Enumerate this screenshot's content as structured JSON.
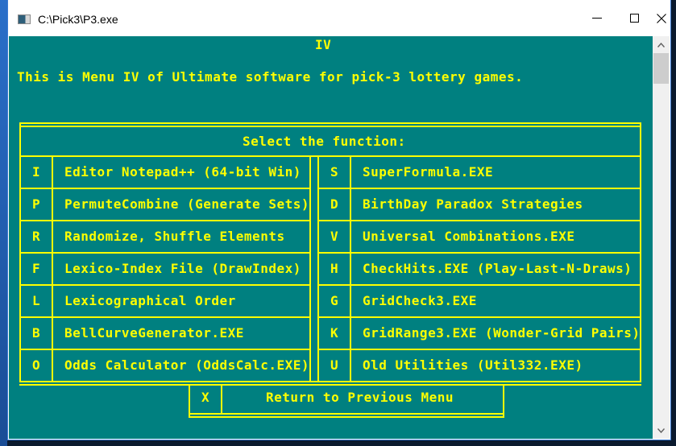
{
  "window": {
    "title": "C:\\Pick3\\P3.exe",
    "controls": {
      "minimize": "minimize",
      "maximize": "maximize",
      "close": "close"
    }
  },
  "console": {
    "heading": "IV",
    "intro": "This is Menu IV of Ultimate software for pick-3 lottery games.",
    "menu_header": "Select the function:",
    "left_items": [
      {
        "key": "I",
        "label": "Editor Notepad++ (64-bit Win)"
      },
      {
        "key": "P",
        "label": "PermuteCombine (Generate Sets)"
      },
      {
        "key": "R",
        "label": "Randomize, Shuffle Elements"
      },
      {
        "key": "F",
        "label": "Lexico-Index File (DrawIndex)"
      },
      {
        "key": "L",
        "label": "Lexicographical Order"
      },
      {
        "key": "B",
        "label": "BellCurveGenerator.EXE"
      },
      {
        "key": "O",
        "label": "Odds Calculator (OddsCalc.EXE)"
      }
    ],
    "right_items": [
      {
        "key": "S",
        "label": "SuperFormula.EXE"
      },
      {
        "key": "D",
        "label": "BirthDay Paradox Strategies"
      },
      {
        "key": "V",
        "label": "Universal Combinations.EXE"
      },
      {
        "key": "H",
        "label": "CheckHits.EXE (Play-Last-N-Draws)"
      },
      {
        "key": "G",
        "label": "GridCheck3.EXE"
      },
      {
        "key": "K",
        "label": "GridRange3.EXE (Wonder-Grid Pairs)"
      },
      {
        "key": "U",
        "label": "Old Utilities (Util332.EXE)"
      }
    ],
    "exit_item": {
      "key": "X",
      "label": "Return to Previous Menu"
    }
  },
  "colors": {
    "background": "#008080",
    "foreground": "#ffff00",
    "scrollbar": "#f0f0f0",
    "thumb": "#cdcdcd"
  }
}
